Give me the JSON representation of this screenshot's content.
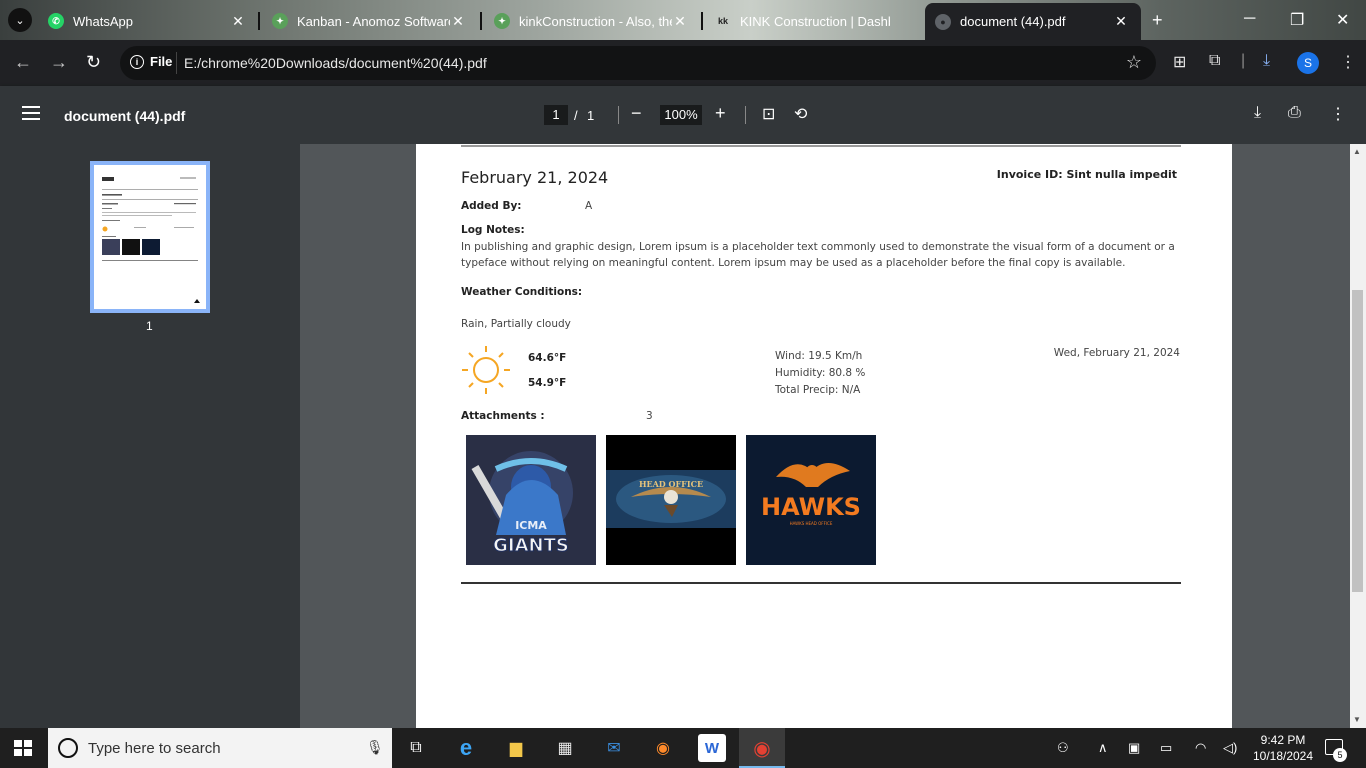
{
  "browser": {
    "tabs": [
      {
        "title": "WhatsApp",
        "active": false
      },
      {
        "title": "Kanban - Anomoz Softwares",
        "active": false
      },
      {
        "title": "kinkConstruction - Also, the",
        "active": false
      },
      {
        "title": "KINK Construction | Dashbo",
        "active": false
      },
      {
        "title": "document (44).pdf",
        "active": true
      }
    ],
    "scheme_label": "File",
    "url": "E:/chrome%20Downloads/document%20(44).pdf",
    "profile_initial": "S"
  },
  "pdf_toolbar": {
    "title": "document (44).pdf",
    "current_page": "1",
    "page_sep": "/",
    "total_pages": "1",
    "zoom": "100%"
  },
  "thumbnail": {
    "page_label": "1"
  },
  "document": {
    "date": "February 21, 2024",
    "invoice_id": "Invoice ID: Sint nulla impedit",
    "added_by_label": "Added By:",
    "added_by_value": "A",
    "log_notes_label": "Log Notes:",
    "log_notes_text": "In publishing and graphic design, Lorem ipsum is a placeholder text commonly used to demonstrate the visual form of a document or a typeface without relying on meaningful content. Lorem ipsum may be used as a placeholder before the final copy is available.",
    "weather_label": "Weather Conditions:",
    "weather_value": "Rain, Partially cloudy",
    "temp_high": "64.6°F",
    "temp_low": "54.9°F",
    "wind": "Wind:   19.5 Km/h",
    "humidity": "Humidity:   80.8 %",
    "precip": "Total Precip:   N/A",
    "weather_date": "Wed, February 21, 2024",
    "attachments_label": "Attachments :",
    "attachments_count": "3",
    "attachments": [
      {
        "name": "giants-logo",
        "line1": "ICMA",
        "line2": "GIANTS"
      },
      {
        "name": "head-office-logo",
        "line1": "HEAD OFFICE"
      },
      {
        "name": "hawks-logo",
        "line1": "HAWKS",
        "line2": "HAWKS HEAD OFFICE"
      }
    ]
  },
  "taskbar": {
    "search_placeholder": "Type here to search",
    "time": "9:42 PM",
    "date": "10/18/2024",
    "notification_count": "5"
  },
  "colors": {
    "accent": "#1a73e8",
    "viewer_bg": "#525659",
    "toolbar_bg": "#323639",
    "sun": "#f5a623",
    "hawks_orange": "#f47b20"
  }
}
